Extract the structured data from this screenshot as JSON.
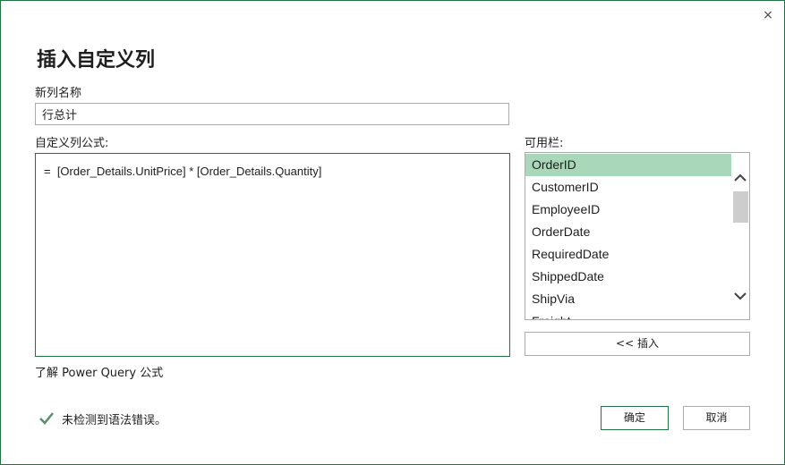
{
  "dialog": {
    "title": "插入自定义列",
    "close_glyph": "×"
  },
  "name_field": {
    "label": "新列名称",
    "value": "行总计"
  },
  "formula_field": {
    "label": "自定义列公式:",
    "value": "=  [Order_Details.UnitPrice] * [Order_Details.Quantity]"
  },
  "available_columns": {
    "label": "可用栏:",
    "items": [
      "OrderID",
      "CustomerID",
      "EmployeeID",
      "OrderDate",
      "RequiredDate",
      "ShippedDate",
      "ShipVia",
      "Freight"
    ],
    "selected": "OrderID",
    "insert_label": "<< 插入"
  },
  "help_link": "了解 Power Query 公式",
  "status": {
    "text": "未检测到语法错误。",
    "icon": "checkmark-icon",
    "color": "#5a8f6a"
  },
  "buttons": {
    "ok": "确定",
    "cancel": "取消"
  },
  "colors": {
    "accent": "#217346",
    "selection": "#a8d8b9"
  }
}
